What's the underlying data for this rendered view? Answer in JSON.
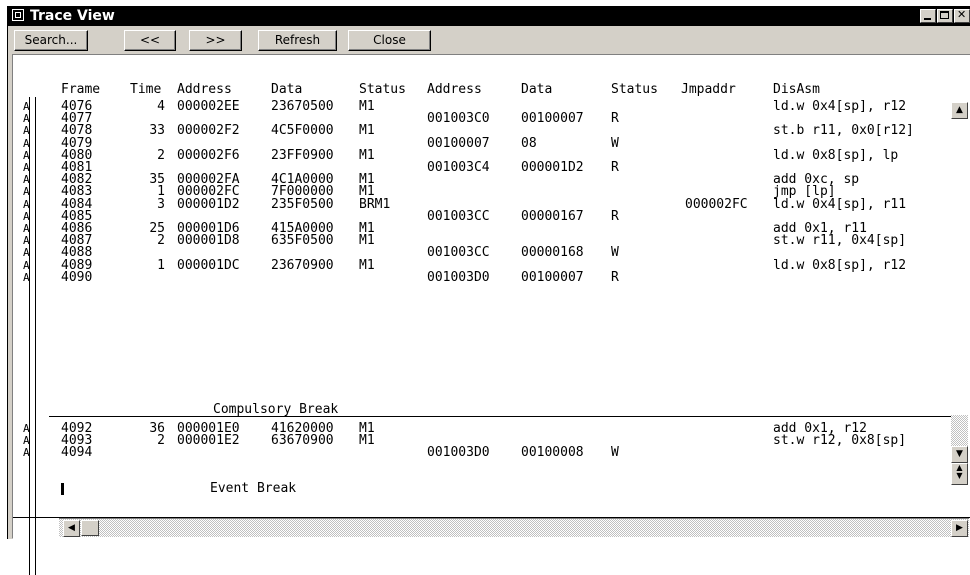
{
  "window": {
    "title": "Trace View"
  },
  "toolbar": {
    "search_label": "Search...",
    "prev_label": "<<",
    "next_label": ">>",
    "refresh_label": "Refresh",
    "close_label": "Close"
  },
  "columns": [
    "Frame",
    "Time",
    "Address",
    "Data",
    "Status",
    "Address",
    "Data",
    "Status",
    "Jmpaddr",
    "DisAsm"
  ],
  "rows": [
    {
      "mark": "A",
      "frame": "4076",
      "time": "4",
      "address": "000002EE",
      "data": "23670500",
      "status": "M1",
      "addr2": "",
      "data2": "",
      "status2": "",
      "jmp": "",
      "disasm": "ld.w 0x4[sp], r12"
    },
    {
      "mark": "A",
      "frame": "4077",
      "time": "",
      "address": "",
      "data": "",
      "status": "",
      "addr2": "001003C0",
      "data2": "00100007",
      "status2": "R",
      "jmp": "",
      "disasm": ""
    },
    {
      "mark": "A",
      "frame": "4078",
      "time": "33",
      "address": "000002F2",
      "data": "4C5F0000",
      "status": "M1",
      "addr2": "",
      "data2": "",
      "status2": "",
      "jmp": "",
      "disasm": "st.b r11, 0x0[r12]"
    },
    {
      "mark": "A",
      "frame": "4079",
      "time": "",
      "address": "",
      "data": "",
      "status": "",
      "addr2": "00100007",
      "data2": "08",
      "status2": "W",
      "jmp": "",
      "disasm": ""
    },
    {
      "mark": "A",
      "frame": "4080",
      "time": "2",
      "address": "000002F6",
      "data": "23FF0900",
      "status": "M1",
      "addr2": "",
      "data2": "",
      "status2": "",
      "jmp": "",
      "disasm": "ld.w 0x8[sp], lp"
    },
    {
      "mark": "A",
      "frame": "4081",
      "time": "",
      "address": "",
      "data": "",
      "status": "",
      "addr2": "001003C4",
      "data2": "000001D2",
      "status2": "R",
      "jmp": "",
      "disasm": ""
    },
    {
      "mark": "A",
      "frame": "4082",
      "time": "35",
      "address": "000002FA",
      "data": "4C1A0000",
      "status": "M1",
      "addr2": "",
      "data2": "",
      "status2": "",
      "jmp": "",
      "disasm": "add 0xc, sp"
    },
    {
      "mark": "A",
      "frame": "4083",
      "time": "1",
      "address": "000002FC",
      "data": "7F000000",
      "status": "M1",
      "addr2": "",
      "data2": "",
      "status2": "",
      "jmp": "",
      "disasm": "jmp [lp]"
    },
    {
      "mark": "A",
      "frame": "4084",
      "time": "3",
      "address": "000001D2",
      "data": "235F0500",
      "status": "BRM1",
      "addr2": "",
      "data2": "",
      "status2": "",
      "jmp": "000002FC",
      "disasm": "ld.w 0x4[sp], r11"
    },
    {
      "mark": "A",
      "frame": "4085",
      "time": "",
      "address": "",
      "data": "",
      "status": "",
      "addr2": "001003CC",
      "data2": "00000167",
      "status2": "R",
      "jmp": "",
      "disasm": ""
    },
    {
      "mark": "A",
      "frame": "4086",
      "time": "25",
      "address": "000001D6",
      "data": "415A0000",
      "status": "M1",
      "addr2": "",
      "data2": "",
      "status2": "",
      "jmp": "",
      "disasm": "add 0x1, r11"
    },
    {
      "mark": "A",
      "frame": "4087",
      "time": "2",
      "address": "000001D8",
      "data": "635F0500",
      "status": "M1",
      "addr2": "",
      "data2": "",
      "status2": "",
      "jmp": "",
      "disasm": "st.w r11, 0x4[sp]"
    },
    {
      "mark": "A",
      "frame": "4088",
      "time": "",
      "address": "",
      "data": "",
      "status": "",
      "addr2": "001003CC",
      "data2": "00000168",
      "status2": "W",
      "jmp": "",
      "disasm": ""
    },
    {
      "mark": "A",
      "frame": "4089",
      "time": "1",
      "address": "000001DC",
      "data": "23670900",
      "status": "M1",
      "addr2": "",
      "data2": "",
      "status2": "",
      "jmp": "",
      "disasm": "ld.w 0x8[sp], r12"
    },
    {
      "mark": "A",
      "frame": "4090",
      "time": "",
      "address": "",
      "data": "",
      "status": "",
      "addr2": "001003D0",
      "data2": "00100007",
      "status2": "R",
      "jmp": "",
      "disasm": ""
    }
  ],
  "compulsory_break": "Compulsory Break",
  "rows2": [
    {
      "mark": "A",
      "frame": "4092",
      "time": "36",
      "address": "000001E0",
      "data": "41620000",
      "status": "M1",
      "addr2": "",
      "data2": "",
      "status2": "",
      "jmp": "",
      "disasm": "add 0x1, r12"
    },
    {
      "mark": "A",
      "frame": "4093",
      "time": "2",
      "address": "000001E2",
      "data": "63670900",
      "status": "M1",
      "addr2": "",
      "data2": "",
      "status2": "",
      "jmp": "",
      "disasm": "st.w r12, 0x8[sp]"
    },
    {
      "mark": "A",
      "frame": "4094",
      "time": "",
      "address": "",
      "data": "",
      "status": "",
      "addr2": "001003D0",
      "data2": "00100008",
      "status2": "W",
      "jmp": "",
      "disasm": ""
    }
  ],
  "event_break": "Event Break"
}
